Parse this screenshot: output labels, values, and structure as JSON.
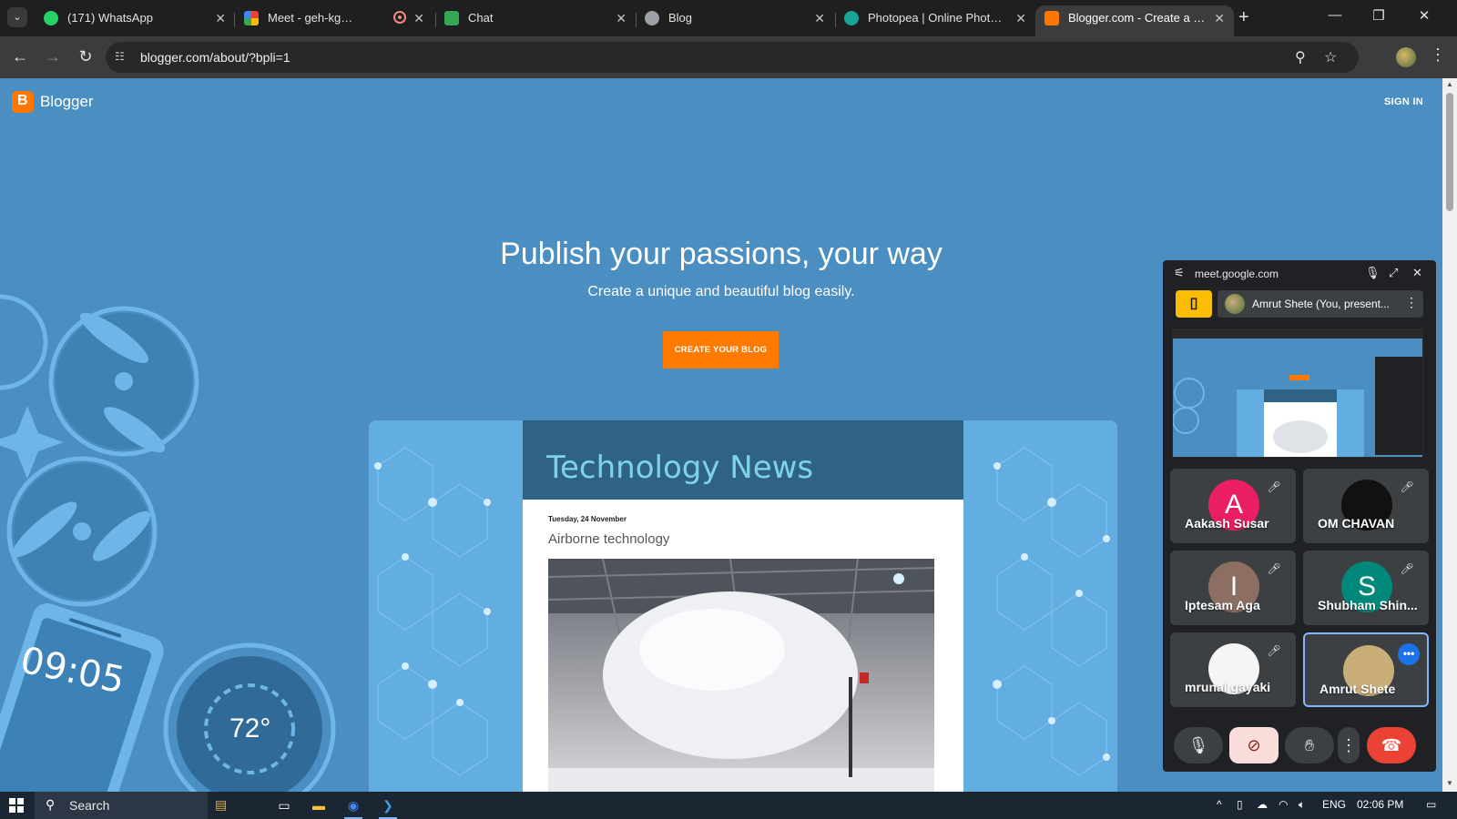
{
  "browser": {
    "tabs": [
      {
        "label": "(171) WhatsApp",
        "favicon_color": "#25d366",
        "active": false
      },
      {
        "label": "Meet - geh-kgmv-xvj",
        "favicon_color": "#00897b",
        "active": false
      },
      {
        "label": "Chat",
        "favicon_color": "#34a853",
        "active": false
      },
      {
        "label": "Blog",
        "favicon_color": "#9aa0a6",
        "active": false
      },
      {
        "label": "Photopea | Online Photo Edi",
        "favicon_color": "#18a497",
        "active": false
      },
      {
        "label": "Blogger.com - Create a uniq",
        "favicon_color": "#ff7700",
        "active": true
      }
    ],
    "tab_close_glyph": "✕",
    "new_tab_glyph": "+",
    "window_controls": {
      "minimize": "—",
      "maximize": "❐",
      "close": "✕"
    },
    "nav": {
      "back": "←",
      "forward": "→",
      "reload": "↻"
    },
    "url": "blogger.com/about/?bpli=1",
    "omnibox_icons": [
      "zoom-icon",
      "star-icon"
    ]
  },
  "page": {
    "brand": "Blogger",
    "sign_in": "SIGN IN",
    "headline": "Publish your passions, your way",
    "subheadline": "Create a unique and beautiful blog easily.",
    "cta": "CREATE YOUR BLOG",
    "phone_time": "09:05",
    "thermostat": "72°",
    "preview": {
      "blog_title": "Technology News",
      "post_date": "Tuesday, 24 November",
      "post_title": "Airborne technology"
    },
    "accent_color": "#ff7a00",
    "background_color": "#4a8ec2"
  },
  "meet_pip": {
    "origin": "meet.google.com",
    "presenter": "Amrut Shete (You, present...",
    "participants": [
      {
        "name": "Aakash Susar",
        "initial": "A",
        "avatar_color": "#e91e63",
        "muted": true
      },
      {
        "name": "OM CHAVAN",
        "initial": "",
        "avatar_color": "#111111",
        "muted": true
      },
      {
        "name": "Iptesam Aga",
        "initial": "I",
        "avatar_color": "#8d6e63",
        "muted": true
      },
      {
        "name": "Shubham Shin...",
        "initial": "S",
        "avatar_color": "#00897b",
        "muted": true
      },
      {
        "name": "mrunal gayaki",
        "initial": "",
        "avatar_color": "#f5f5f5",
        "muted": true
      },
      {
        "name": "Amrut Shete",
        "initial": "",
        "avatar_color": "#c9ae7a",
        "muted": false,
        "speaking": true
      }
    ],
    "more_glyph": "•••"
  },
  "taskbar": {
    "search_label": "Search",
    "language": "ENG",
    "time": "02:06 PM"
  }
}
